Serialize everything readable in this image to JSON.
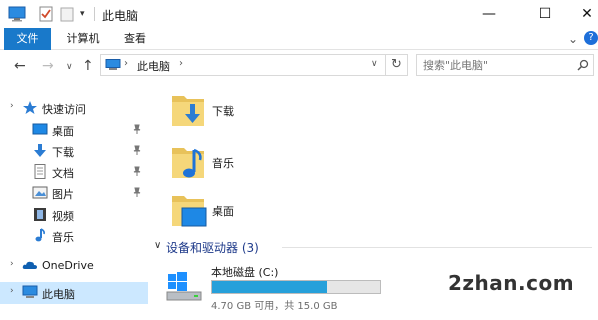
{
  "window": {
    "title": "此电脑",
    "minimize": "—",
    "maximize": "☐",
    "close": "✕"
  },
  "quick_access_toolbar": {
    "dropdown": "▾"
  },
  "ribbon": {
    "tabs": [
      "文件",
      "计算机",
      "查看"
    ],
    "collapse": "⌄",
    "help": "?"
  },
  "navigation": {
    "back": "←",
    "forward": "→",
    "recent": "∨",
    "up": "↑",
    "address": "此电脑",
    "refresh": "↻",
    "search_placeholder": "搜索\"此电脑\""
  },
  "sidebar": {
    "items": [
      {
        "label": "快速访问",
        "icon": "star-icon"
      },
      {
        "label": "桌面",
        "icon": "desktop-icon",
        "pinned": true
      },
      {
        "label": "下载",
        "icon": "download-icon",
        "pinned": true
      },
      {
        "label": "文档",
        "icon": "document-icon",
        "pinned": true
      },
      {
        "label": "图片",
        "icon": "picture-icon",
        "pinned": true
      },
      {
        "label": "视频",
        "icon": "video-icon"
      },
      {
        "label": "音乐",
        "icon": "music-icon"
      },
      {
        "label": "OneDrive",
        "icon": "cloud-icon"
      },
      {
        "label": "此电脑",
        "icon": "computer-icon",
        "selected": true
      }
    ]
  },
  "main": {
    "folders": [
      {
        "label": "下载",
        "icon": "download-folder-icon"
      },
      {
        "label": "音乐",
        "icon": "music-folder-icon"
      },
      {
        "label": "桌面",
        "icon": "desktop-folder-icon"
      }
    ],
    "group": {
      "chevron": "∨",
      "title": "设备和驱动器 (3)"
    },
    "drive": {
      "name": "本地磁盘 (C:)",
      "info": "4.70 GB 可用，共 15.0 GB",
      "used_fraction": 0.687,
      "bar_color": "#26a0da"
    }
  },
  "watermark": "2zhan.com",
  "colors": {
    "accent": "#1979ca",
    "selection": "#cce8ff",
    "group_title": "#1e3a8a"
  }
}
